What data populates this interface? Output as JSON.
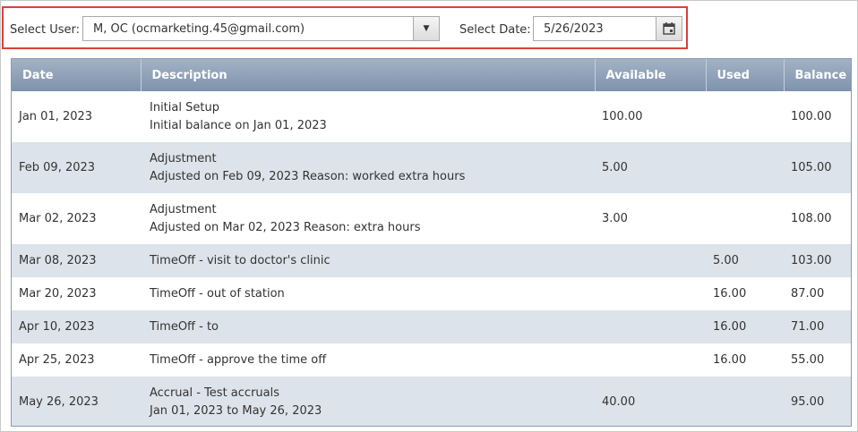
{
  "filters": {
    "user_label": "Select User:",
    "user_value": "M, OC (ocmarketing.45@gmail.com)",
    "date_label": "Select Date:",
    "date_value": "5/26/2023"
  },
  "table": {
    "headers": [
      "Date",
      "Description",
      "Available",
      "Used",
      "Balance"
    ],
    "rows": [
      {
        "date": "Jan 01, 2023",
        "desc1": "Initial Setup",
        "desc2": "Initial balance on Jan 01, 2023",
        "available": "100.00",
        "used": "",
        "balance": "100.00"
      },
      {
        "date": "Feb 09, 2023",
        "desc1": "Adjustment",
        "desc2": "Adjusted on Feb 09, 2023 Reason: worked extra hours",
        "available": "5.00",
        "used": "",
        "balance": "105.00"
      },
      {
        "date": "Mar 02, 2023",
        "desc1": "Adjustment",
        "desc2": "Adjusted on Mar 02, 2023 Reason: extra hours",
        "available": "3.00",
        "used": "",
        "balance": "108.00"
      },
      {
        "date": "Mar 08, 2023",
        "desc1": "TimeOff - visit to doctor's clinic",
        "desc2": "",
        "available": "",
        "used": "5.00",
        "balance": "103.00"
      },
      {
        "date": "Mar 20, 2023",
        "desc1": "TimeOff - out of station",
        "desc2": "",
        "available": "",
        "used": "16.00",
        "balance": "87.00"
      },
      {
        "date": "Apr 10, 2023",
        "desc1": "TimeOff - to",
        "desc2": "",
        "available": "",
        "used": "16.00",
        "balance": "71.00"
      },
      {
        "date": "Apr 25, 2023",
        "desc1": "TimeOff - approve the time off",
        "desc2": "",
        "available": "",
        "used": "16.00",
        "balance": "55.00"
      },
      {
        "date": "May 26, 2023",
        "desc1": "Accrual - Test accruals",
        "desc2": "Jan 01, 2023 to May 26, 2023",
        "available": "40.00",
        "used": "",
        "balance": "95.00"
      }
    ]
  }
}
